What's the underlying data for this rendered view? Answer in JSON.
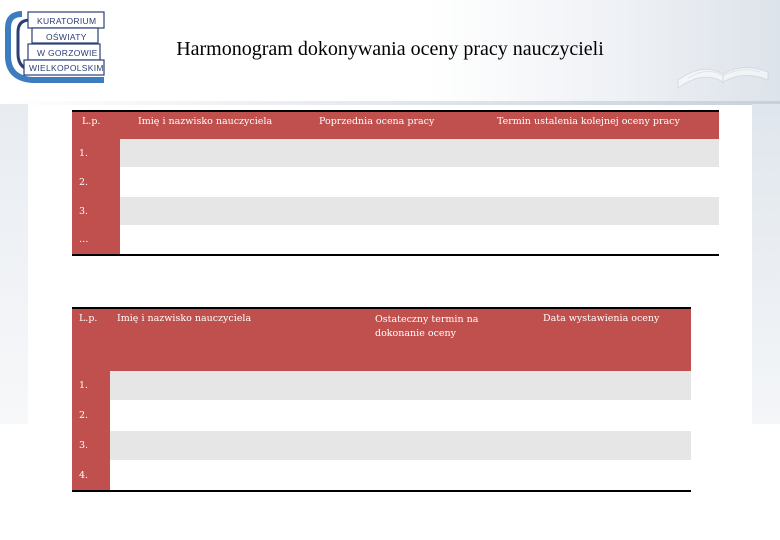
{
  "logo": {
    "lines": [
      "KURATORIUM",
      "OŚWIATY",
      "W GORZOWIE",
      "WIELKOPOLSKIM"
    ],
    "colors": {
      "primary": "#2a3f73",
      "accent": "#3e7cc0"
    }
  },
  "title": "Harmonogram dokonywania oceny pracy nauczycieli",
  "table1": {
    "headers": [
      "L.p.",
      "Imię i nazwisko nauczyciela",
      "Poprzednia ocena pracy",
      "Termin ustalenia kolejnej oceny pracy"
    ],
    "rows": [
      "1.",
      "2.",
      "3.",
      "…"
    ]
  },
  "table2": {
    "headers": [
      "L.p.",
      "Imię i nazwisko nauczyciela",
      "Ostateczny termin na dokonanie oceny",
      "Data wystawienia oceny"
    ],
    "rows": [
      "1.",
      "2.",
      "3.",
      "4."
    ]
  },
  "colors": {
    "header_bg": "#c0504d",
    "stripe": "#e6e6e6"
  }
}
